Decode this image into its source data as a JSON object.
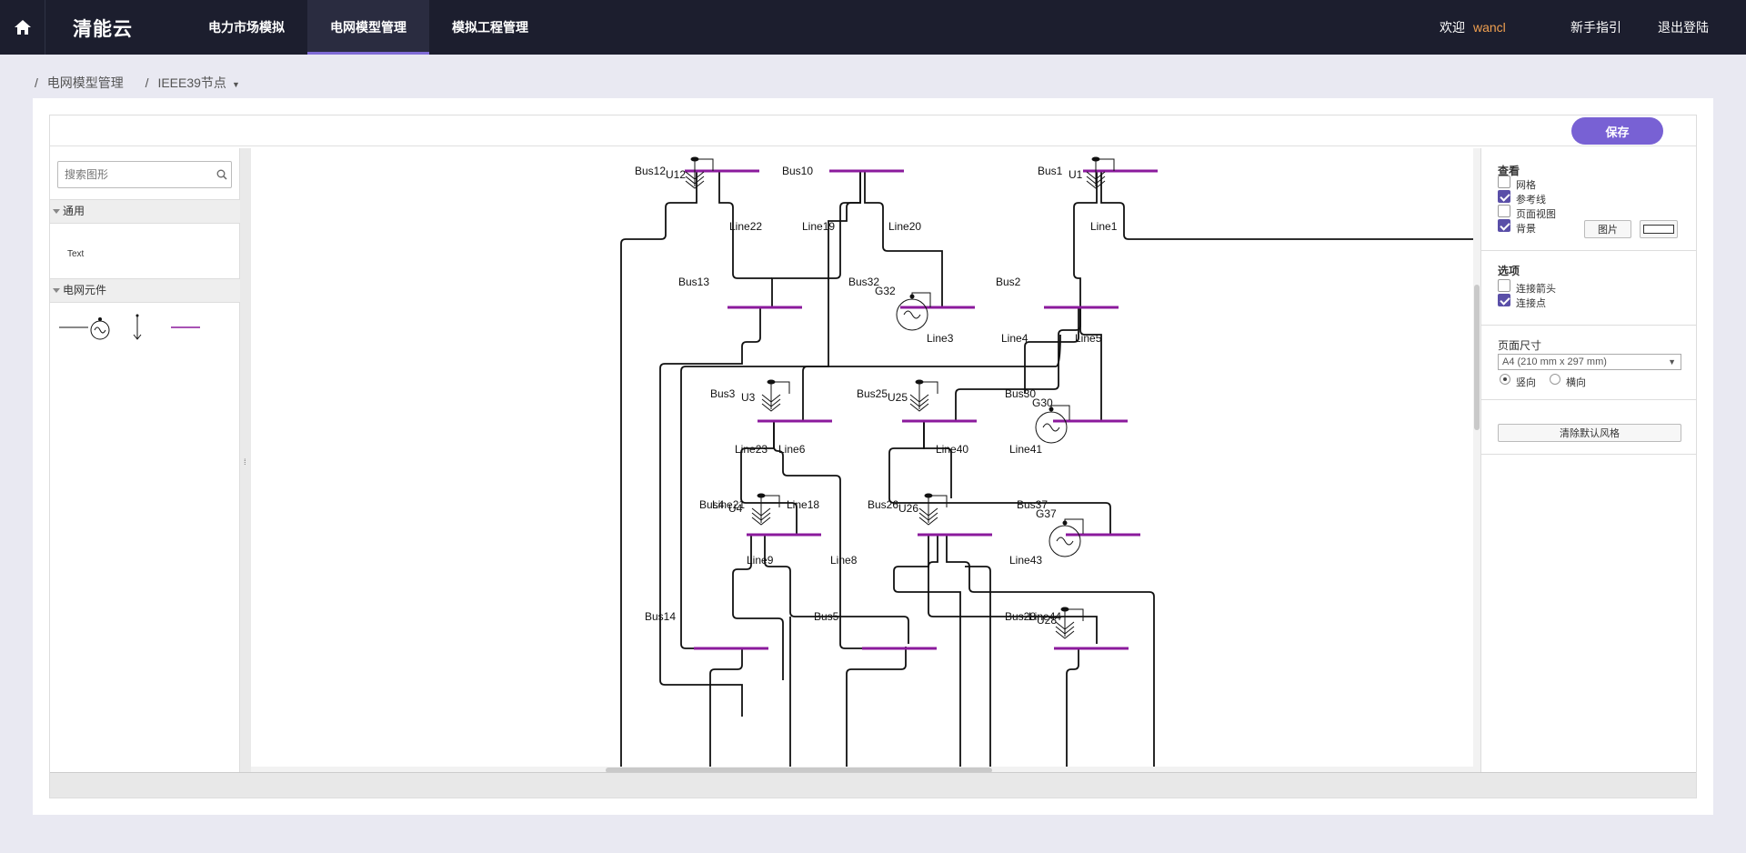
{
  "topbar": {
    "brand": "清能云",
    "nav": [
      "电力市场模拟",
      "电网模型管理",
      "模拟工程管理"
    ],
    "active_index": 1,
    "welcome": "欢迎",
    "user": "wancl",
    "guide": "新手指引",
    "logout": "退出登陆"
  },
  "breadcrumb": {
    "sep": "/",
    "items": [
      "电网模型管理",
      "IEEE39节点"
    ]
  },
  "toolbar": {
    "save_label": "保存"
  },
  "leftpanel": {
    "search_placeholder": "搜索图形",
    "section_general": "通用",
    "text_item": "Text",
    "section_elements": "电网元件"
  },
  "rightpanel": {
    "view_title": "查看",
    "grid": "网格",
    "guides": "参考线",
    "page_view": "页面视图",
    "background": "背景",
    "image_btn": "图片",
    "options_title": "选项",
    "connect_arrows": "连接箭头",
    "connect_points": "连接点",
    "page_size_title": "页面尺寸",
    "page_size_value": "A4 (210 mm x 297 mm)",
    "portrait": "竖向",
    "landscape": "横向",
    "clear_style": "清除默认风格"
  },
  "diagram": {
    "labels": [
      "Bus12",
      "U12",
      "Bus10",
      "Bus1",
      "U1",
      "Line22",
      "Line19",
      "Line20",
      "Line1",
      "Bus13",
      "Bus32",
      "G32",
      "Bus2",
      "Line3",
      "Line4",
      "Line5",
      "Bus3",
      "U3",
      "Bus25",
      "U25",
      "Bus30",
      "G30",
      "Line23",
      "Line6",
      "Line40",
      "Line41",
      "Bus4",
      "Line21",
      "U4",
      "Line18",
      "Bus26",
      "U26",
      "Bus37",
      "G37",
      "Line9",
      "Line8",
      "Line43",
      "Bus14",
      "Bus5",
      "Bus28",
      "Line44",
      "U28"
    ]
  },
  "colors": {
    "accent": "#7861d4",
    "bus": "#8b1a9c",
    "topbar": "#1c1e2e",
    "user": "#f0a050"
  }
}
